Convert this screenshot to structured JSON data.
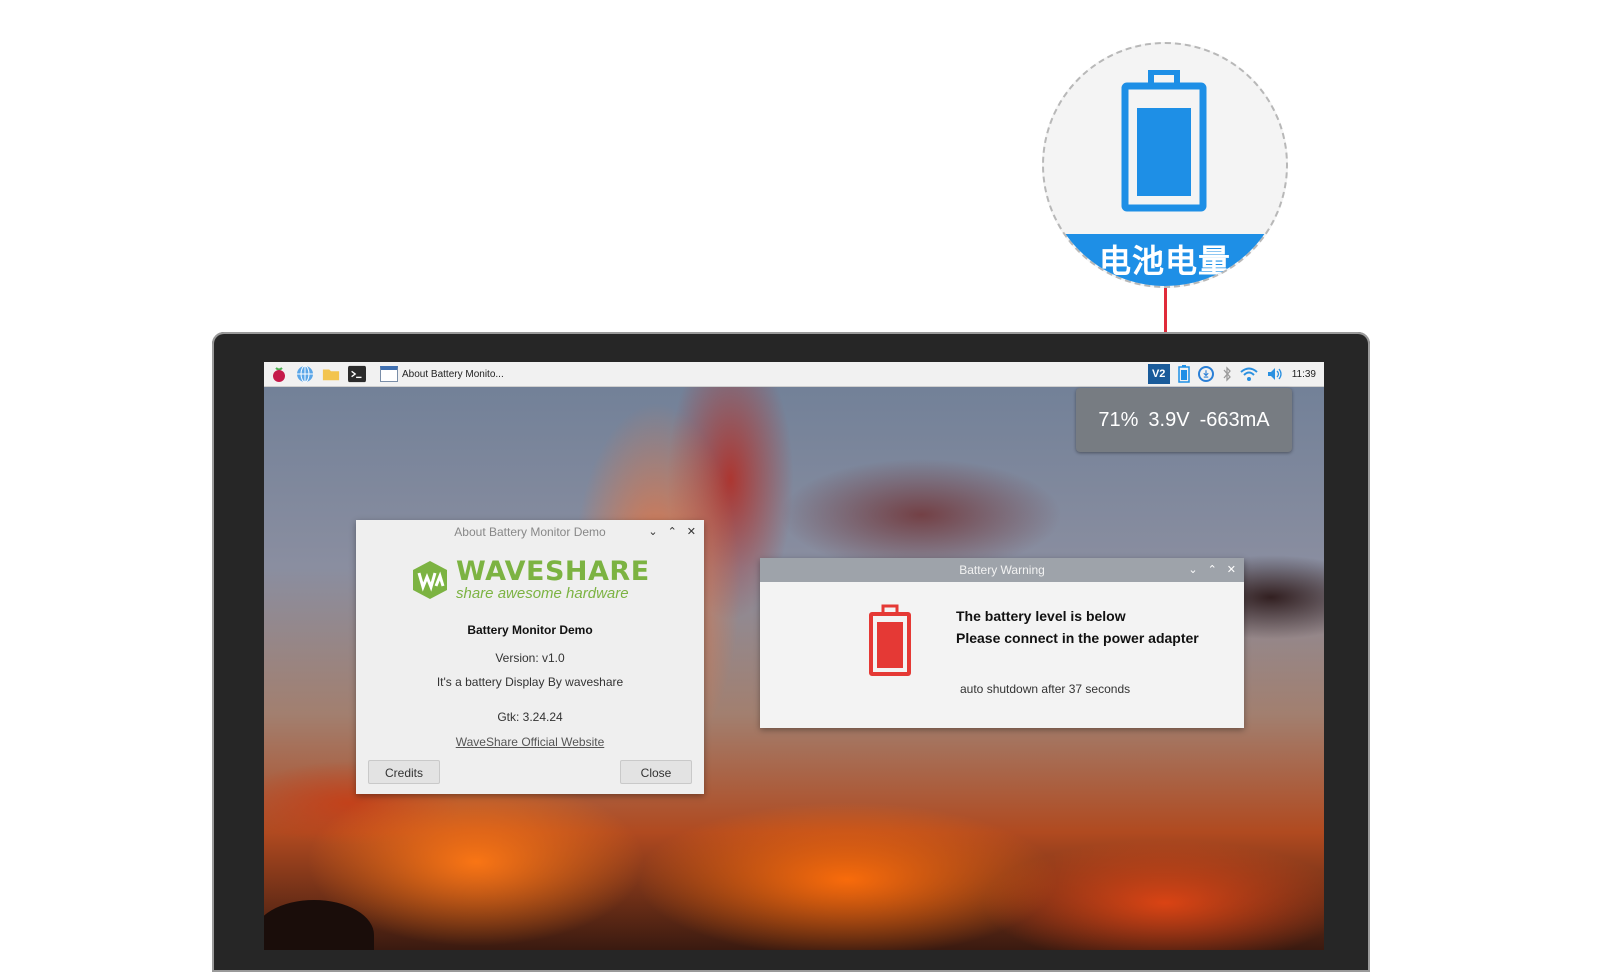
{
  "callout": {
    "label": "电池电量",
    "color": "#1e8fe6",
    "connector_color": "#e02b3a",
    "icon": "battery-full-icon"
  },
  "taskbar": {
    "window_button": "About Battery Monito...",
    "time": "11:39",
    "vnc_label": "V2",
    "icons": [
      "raspberry-pi-icon",
      "web-browser-icon",
      "file-manager-icon",
      "terminal-icon",
      "vnc-icon",
      "battery-icon",
      "download-icon",
      "bluetooth-icon",
      "wifi-icon",
      "volume-icon"
    ]
  },
  "tooltip": {
    "percent": "71%",
    "voltage": "3.9V",
    "current": "-663mA"
  },
  "about_dialog": {
    "title": "About Battery Monitor Demo",
    "logo_word": "WAVESHARE",
    "logo_tagline": "share awesome hardware",
    "app_name": "Battery Monitor Demo",
    "version": "Version: v1.0",
    "description": "It's a battery Display By waveshare",
    "gtk": "Gtk: 3.24.24",
    "link": "WaveShare Official Website",
    "credits_button": "Credits",
    "close_button": "Close",
    "brand_color": "#7cb342"
  },
  "warning_dialog": {
    "title": "Battery Warning",
    "line1": "The battery level is below",
    "line2": "Please connect in the power adapter",
    "note": "auto shutdown after 37 seconds",
    "icon_color": "#e53935"
  }
}
